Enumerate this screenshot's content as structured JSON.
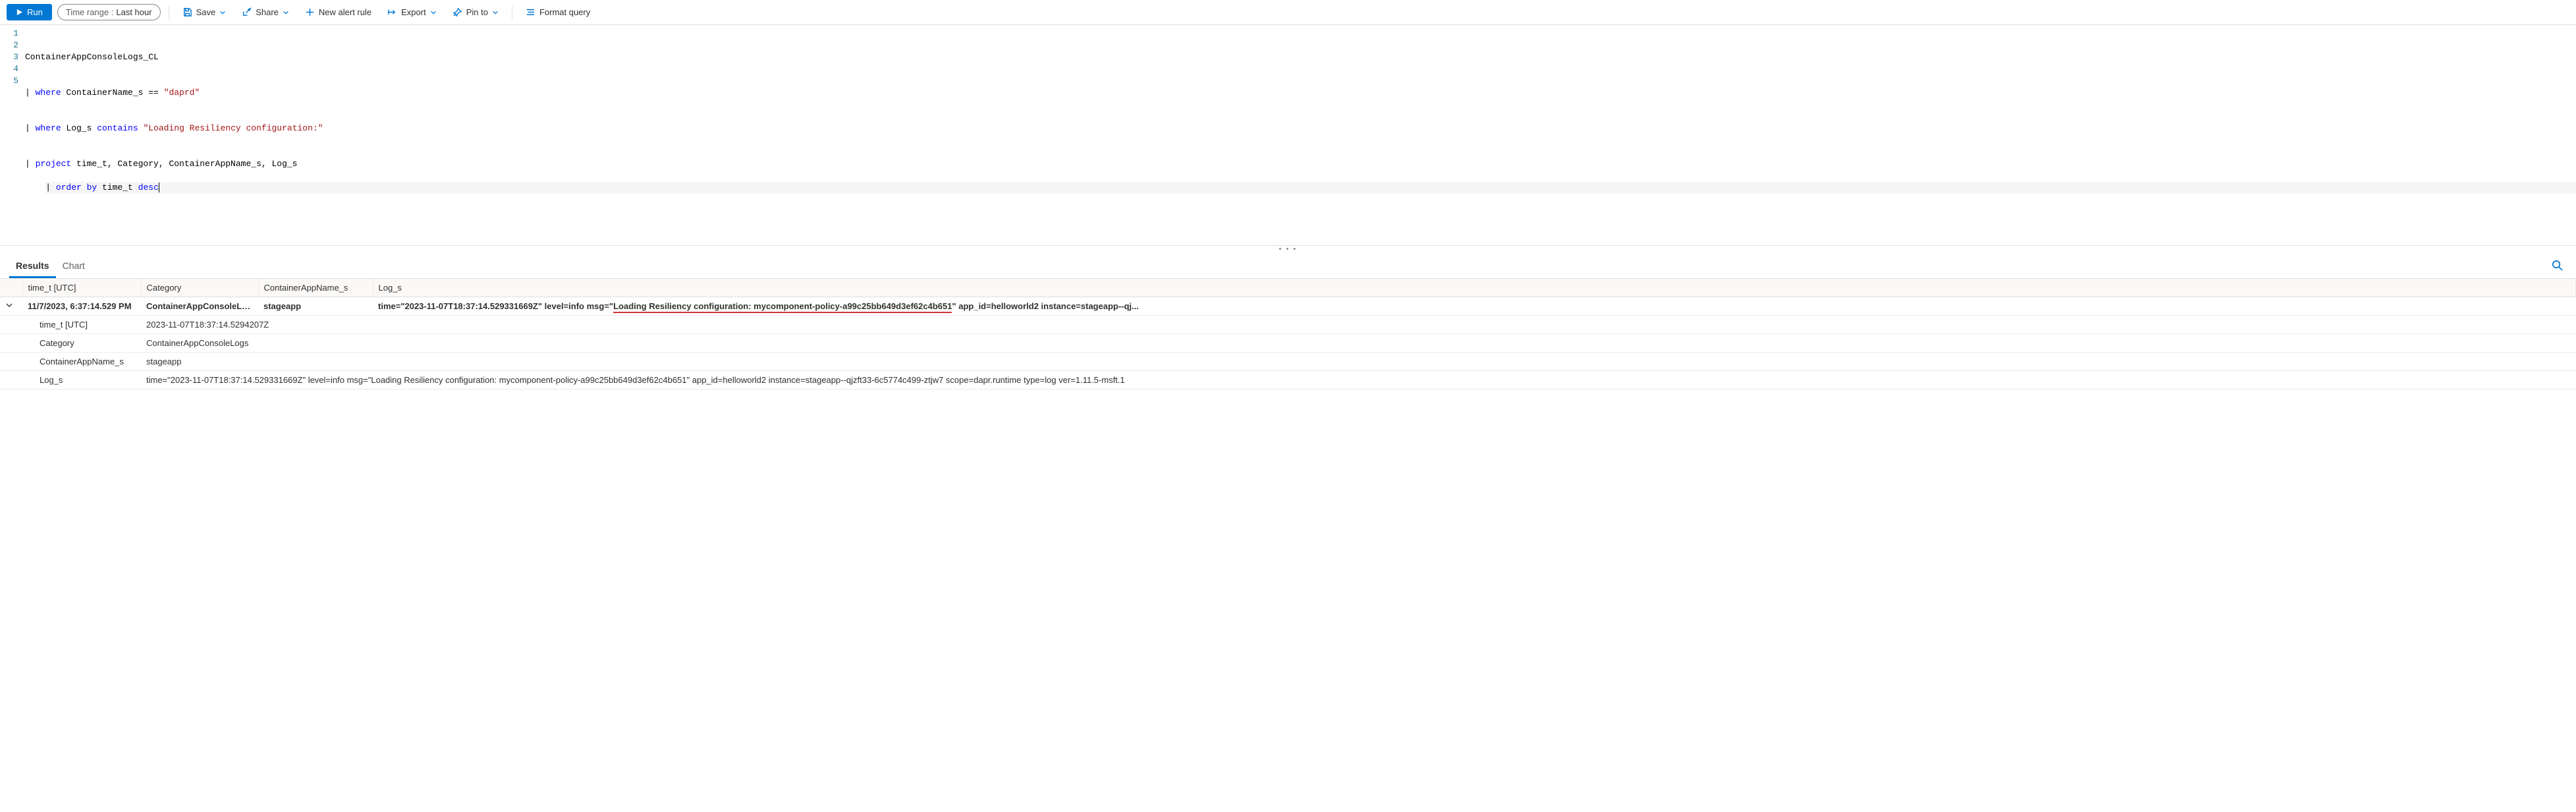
{
  "toolbar": {
    "run_label": "Run",
    "time_range_label": "Time range :",
    "time_range_value": "Last hour",
    "save_label": "Save",
    "share_label": "Share",
    "new_alert_label": "New alert rule",
    "export_label": "Export",
    "pin_to_label": "Pin to",
    "format_label": "Format query"
  },
  "editor": {
    "lines": {
      "l1": "ContainerAppConsoleLogs_CL",
      "l2_pipe": "| ",
      "l2_kw": "where",
      "l2_mid": " ContainerName_s == ",
      "l2_str": "\"daprd\"",
      "l3_pipe": "| ",
      "l3_kw": "where",
      "l3_mid": " Log_s ",
      "l3_kw2": "contains",
      "l3_sp": " ",
      "l3_str": "\"Loading Resiliency configuration:\"",
      "l4_pipe": "| ",
      "l4_kw": "project",
      "l4_rest": " time_t, Category, ContainerAppName_s, Log_s",
      "l5_pipe": "| ",
      "l5_kw": "order by",
      "l5_mid": " time_t ",
      "l5_kw2": "desc"
    },
    "gutter": [
      "1",
      "2",
      "3",
      "4",
      "5"
    ]
  },
  "tabs": {
    "results": "Results",
    "chart": "Chart"
  },
  "table": {
    "headers": {
      "time": "time_t [UTC]",
      "category": "Category",
      "app": "ContainerAppName_s",
      "log": "Log_s"
    },
    "row": {
      "time": "11/7/2023, 6:37:14.529 PM",
      "category": "ContainerAppConsoleLogs",
      "app": "stageapp",
      "log_pre": "time=\"2023-11-07T18:37:14.529331669Z\" level=info msg=\"",
      "log_hi": "Loading Resiliency configuration: mycomponent-policy-a99c25bb649d3ef62c4b651",
      "log_post": "\" app_id=helloworld2 instance=stageapp--qj..."
    },
    "details": [
      {
        "k": "time_t [UTC]",
        "v": "2023-11-07T18:37:14.5294207Z"
      },
      {
        "k": "Category",
        "v": "ContainerAppConsoleLogs"
      },
      {
        "k": "ContainerAppName_s",
        "v": "stageapp"
      },
      {
        "k": "Log_s",
        "v": "time=\"2023-11-07T18:37:14.529331669Z\" level=info msg=\"Loading Resiliency configuration: mycomponent-policy-a99c25bb649d3ef62c4b651\" app_id=helloworld2 instance=stageapp--qjzft33-6c5774c499-ztjw7 scope=dapr.runtime type=log ver=1.11.5-msft.1"
      }
    ]
  }
}
